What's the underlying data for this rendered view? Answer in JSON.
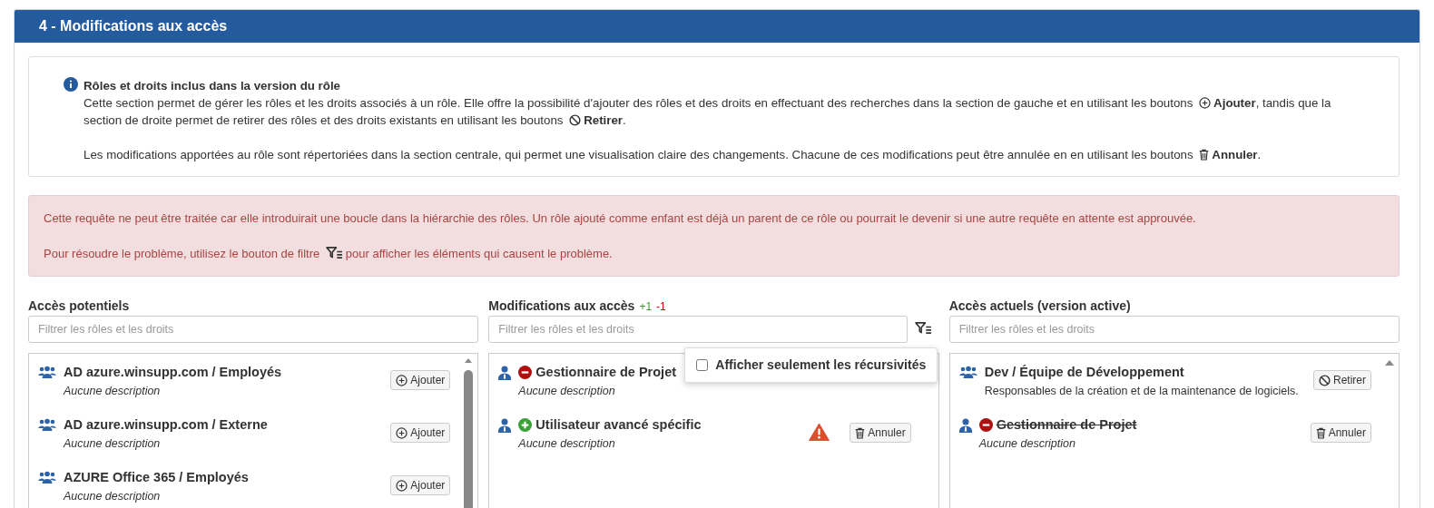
{
  "header": {
    "title": "4 - Modifications aux accès"
  },
  "info": {
    "title": "Rôles et droits inclus dans la version du rôle",
    "paragraphs": [
      [
        {
          "kind": "text",
          "text": "Cette section permet de gérer les rôles et les droits associés à un rôle. Elle offre la possibilité d'ajouter des rôles et des droits en effectuant des recherches dans la section de gauche et en utilisant les boutons"
        },
        {
          "kind": "add"
        },
        {
          "kind": "text",
          "text": "**Ajouter**, tandis que la"
        },
        {
          "kind": "text",
          "text": "section de droite permet de retirer des rôles et des droits existants en utilisant les boutons"
        },
        {
          "kind": "remove"
        },
        {
          "kind": "text",
          "text": "**Retirer**."
        }
      ],
      [
        {
          "kind": "text",
          "text": "Les modifications apportées au rôle sont répertoriées dans la section centrale, qui permet une visualisation claire des changements. Chacune de ces modifications peut être annulée en en utilisant les boutons"
        },
        {
          "kind": "cancel"
        },
        {
          "kind": "text",
          "text": "**Annuler**."
        }
      ]
    ]
  },
  "alert": {
    "paragraphs": [
      [
        {
          "kind": "text",
          "text": "Cette requête ne peut être traitée car elle introduirait une boucle dans la hiérarchie des rôles. Un rôle ajouté comme enfant est déjà un parent de ce rôle ou pourrait le devenir si une autre requête en attente est approuvée."
        }
      ],
      [
        {
          "kind": "text",
          "text": "Pour résoudre le problème, utilisez le bouton de filtre"
        },
        {
          "kind": "filter"
        },
        {
          "kind": "text",
          "text": "pour afficher les éléments qui causent le problème."
        }
      ]
    ]
  },
  "columns": [
    {
      "title": "Accès potentiels",
      "filter": {
        "placeholder": "Filtrer les rôles et les droits"
      },
      "items": [
        {
          "kind": "group",
          "name": "AD azure.winsupp.com / Employés",
          "description": {
            "kind": "empty",
            "text": "Aucune description"
          },
          "action": {
            "kind": "add",
            "label": "Ajouter"
          }
        },
        {
          "kind": "group",
          "name": "AD azure.winsupp.com / Externe",
          "description": {
            "kind": "empty",
            "text": "Aucune description"
          },
          "action": {
            "kind": "add",
            "label": "Ajouter"
          }
        },
        {
          "kind": "group",
          "name": "AZURE Office 365 / Employés",
          "description": {
            "kind": "empty",
            "text": "Aucune description"
          },
          "action": {
            "kind": "add",
            "label": "Ajouter"
          }
        }
      ]
    },
    {
      "title": "Modifications aux accès",
      "counts": [
        {
          "kind": "added",
          "text": "+1"
        },
        {
          "kind": "removed",
          "text": "-1"
        }
      ],
      "filter": {
        "placeholder": "Filtrer les rôles et les droits"
      },
      "filter_button": true,
      "popup": {
        "label": "Afficher seulement les récursivités",
        "checked": false
      },
      "items": [
        {
          "kind": "user",
          "change": {
            "kind": "removed"
          },
          "name": "Gestionnaire de Projet",
          "description": {
            "kind": "empty",
            "text": "Aucune description"
          }
        },
        {
          "kind": "user",
          "change": {
            "kind": "added"
          },
          "name": "Utilisateur avancé spécific",
          "description": {
            "kind": "empty",
            "text": "Aucune description"
          },
          "warning": true,
          "action": {
            "kind": "cancel",
            "label": "Annuler"
          }
        }
      ]
    },
    {
      "title": "Accès actuels (version active)",
      "filter": {
        "placeholder": "Filtrer les rôles et les droits"
      },
      "items": [
        {
          "kind": "group",
          "name": "Dev / Équipe de Développement",
          "description": {
            "kind": "text",
            "text": "Responsables de la création et de la maintenance de logiciels."
          },
          "action": {
            "kind": "remove",
            "label": "Retirer"
          }
        },
        {
          "kind": "user",
          "change": {
            "kind": "removed"
          },
          "struck": true,
          "name": "Gestionnaire de Projet",
          "description": {
            "kind": "empty",
            "text": "Aucune description"
          },
          "action": {
            "kind": "cancel",
            "label": "Annuler"
          }
        }
      ]
    }
  ]
}
